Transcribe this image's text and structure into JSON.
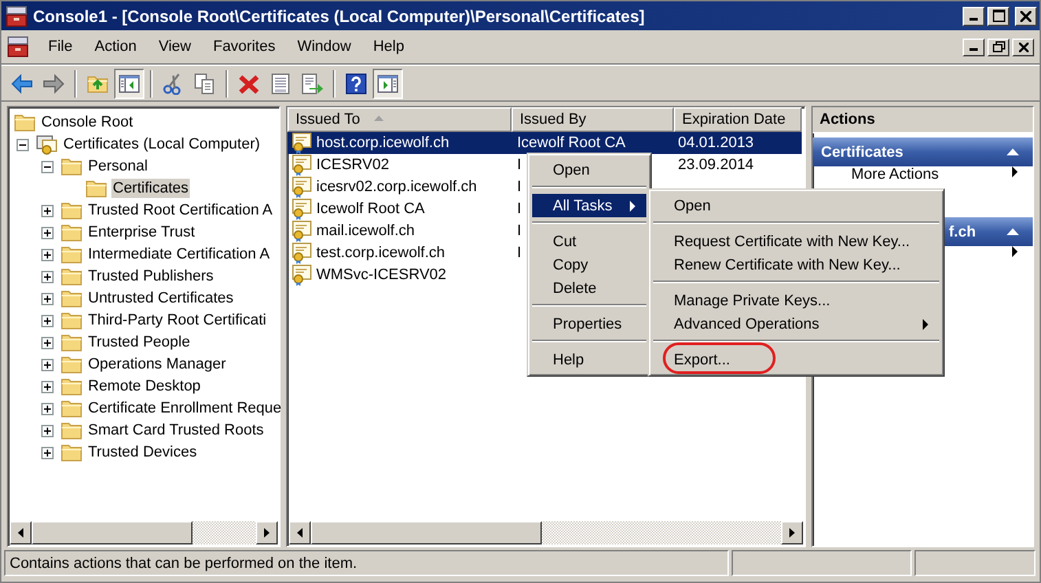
{
  "window": {
    "title": "Console1 - [Console Root\\Certificates (Local Computer)\\Personal\\Certificates]"
  },
  "menu": [
    "File",
    "Action",
    "View",
    "Favorites",
    "Window",
    "Help"
  ],
  "toolbar": [
    {
      "kind": "back",
      "pressed": false
    },
    {
      "kind": "forward",
      "pressed": false
    },
    {
      "kind": "separator"
    },
    {
      "kind": "up",
      "pressed": false
    },
    {
      "kind": "tree-toggle",
      "pressed": true
    },
    {
      "kind": "separator"
    },
    {
      "kind": "cut",
      "pressed": false
    },
    {
      "kind": "copy",
      "pressed": false
    },
    {
      "kind": "separator"
    },
    {
      "kind": "delete",
      "pressed": false
    },
    {
      "kind": "properties",
      "pressed": false
    },
    {
      "kind": "export",
      "pressed": false
    },
    {
      "kind": "separator"
    },
    {
      "kind": "help",
      "pressed": false
    },
    {
      "kind": "action-toggle",
      "pressed": true
    }
  ],
  "tree": [
    {
      "label": "Console Root",
      "kind": "folder",
      "selected": false,
      "children": [
        {
          "label": "Certificates (Local Computer)",
          "kind": "snapin",
          "expanded": true,
          "selected": false,
          "children": [
            {
              "label": "Personal",
              "kind": "folder",
              "expanded": true,
              "selected": false,
              "children": [
                {
                  "label": "Certificates",
                  "kind": "folder",
                  "selected": true
                }
              ]
            },
            {
              "label": "Trusted Root Certification A",
              "kind": "folder",
              "expanded": false,
              "selected": false
            },
            {
              "label": "Enterprise Trust",
              "kind": "folder",
              "expanded": false,
              "selected": false
            },
            {
              "label": "Intermediate Certification A",
              "kind": "folder",
              "expanded": false,
              "selected": false
            },
            {
              "label": "Trusted Publishers",
              "kind": "folder",
              "expanded": false,
              "selected": false
            },
            {
              "label": "Untrusted Certificates",
              "kind": "folder",
              "expanded": false,
              "selected": false
            },
            {
              "label": "Third-Party Root Certificati",
              "kind": "folder",
              "expanded": false,
              "selected": false
            },
            {
              "label": "Trusted People",
              "kind": "folder",
              "expanded": false,
              "selected": false
            },
            {
              "label": "Operations Manager",
              "kind": "folder",
              "expanded": false,
              "selected": false
            },
            {
              "label": "Remote Desktop",
              "kind": "folder",
              "expanded": false,
              "selected": false
            },
            {
              "label": "Certificate Enrollment Reque",
              "kind": "folder",
              "expanded": false,
              "selected": false
            },
            {
              "label": "Smart Card Trusted Roots",
              "kind": "folder",
              "expanded": false,
              "selected": false
            },
            {
              "label": "Trusted Devices",
              "kind": "folder",
              "expanded": false,
              "selected": false
            }
          ]
        }
      ]
    }
  ],
  "list": {
    "columns": [
      {
        "label": "Issued To",
        "sorted": true
      },
      {
        "label": "Issued By",
        "sorted": false
      },
      {
        "label": "Expiration Date",
        "sorted": false
      }
    ],
    "rows": [
      {
        "selected": true,
        "cells": [
          "host.corp.icewolf.ch",
          "Icewolf Root CA",
          "04.01.2013"
        ]
      },
      {
        "selected": false,
        "cells": [
          "ICESRV02",
          "I",
          "23.09.2014"
        ]
      },
      {
        "selected": false,
        "cells": [
          "icesrv02.corp.icewolf.ch",
          "I"
        ]
      },
      {
        "selected": false,
        "cells": [
          "Icewolf Root CA",
          "I"
        ]
      },
      {
        "selected": false,
        "cells": [
          "mail.icewolf.ch",
          "I"
        ]
      },
      {
        "selected": false,
        "cells": [
          "test.corp.icewolf.ch",
          "I"
        ]
      },
      {
        "selected": false,
        "cells": [
          "WMSvc-ICESRV02"
        ]
      }
    ]
  },
  "actions": {
    "title": "Actions",
    "sections": [
      {
        "title": "Certificates",
        "expanded": true,
        "items": [
          {
            "label": "More Actions",
            "submenu": true
          }
        ]
      },
      {
        "title": "f.ch",
        "expanded": true,
        "items": [
          {
            "submenu": true
          }
        ]
      }
    ]
  },
  "context_menu": {
    "items": [
      {
        "kind": "item",
        "label": "Open",
        "selected": false
      },
      {
        "kind": "separator"
      },
      {
        "kind": "item",
        "label": "All Tasks",
        "submenu": true,
        "selected": true
      },
      {
        "kind": "separator"
      },
      {
        "kind": "item",
        "label": "Cut",
        "selected": false
      },
      {
        "kind": "item",
        "label": "Copy",
        "selected": false
      },
      {
        "kind": "item",
        "label": "Delete",
        "selected": false
      },
      {
        "kind": "separator"
      },
      {
        "kind": "item",
        "label": "Properties",
        "selected": false
      },
      {
        "kind": "separator"
      },
      {
        "kind": "item",
        "label": "Help",
        "selected": false
      }
    ]
  },
  "submenu": {
    "items": [
      {
        "kind": "item",
        "label": "Open",
        "selected": false
      },
      {
        "kind": "separator"
      },
      {
        "kind": "item",
        "label": "Request Certificate with New Key...",
        "selected": false
      },
      {
        "kind": "item",
        "label": "Renew Certificate with New Key...",
        "selected": false
      },
      {
        "kind": "separator"
      },
      {
        "kind": "item",
        "label": "Manage Private Keys...",
        "selected": false
      },
      {
        "kind": "item",
        "label": "Advanced Operations",
        "submenu": true,
        "selected": false
      },
      {
        "kind": "separator"
      },
      {
        "kind": "item",
        "label": "Export...",
        "selected": false,
        "circled": true
      }
    ]
  },
  "status_bar": {
    "text": "Contains actions that can be performed on the item."
  }
}
